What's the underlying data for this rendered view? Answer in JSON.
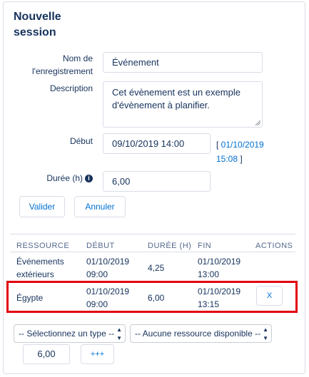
{
  "form": {
    "title": "Nouvelle session",
    "name_label": "Nom de l'enregistrement",
    "name_value": "Événement",
    "description_label": "Description",
    "description_value": "Cet évènement est un exemple d'évènement à planifier.",
    "start_label": "Début",
    "start_value": "09/10/2019 14:00",
    "start_suggestion_open": "[ ",
    "start_suggestion_link": "01/10/2019 15:08",
    "start_suggestion_close": " ]",
    "duration_label": "Durée (h)",
    "duration_value": "6,00",
    "validate_label": "Valider",
    "cancel_label": "Annuler"
  },
  "table": {
    "headers": [
      "RESSOURCE",
      "DÉBUT",
      "DURÉE (H)",
      "FIN",
      "ACTIONS"
    ],
    "rows": [
      {
        "resource": "Événements extérieurs",
        "start": "01/10/2019 09:00",
        "duration": "4,25",
        "end": "01/10/2019 13:00",
        "action": ""
      },
      {
        "resource": "Égypte",
        "start": "01/10/2019 09:00",
        "duration": "6,00",
        "end": "01/10/2019 13:15",
        "action": "X"
      }
    ]
  },
  "add": {
    "type_select": "-- Sélectionnez un type --",
    "resource_select": "-- Aucune ressource disponible --",
    "duration_value": "6,00",
    "add_label": "+++"
  },
  "colors": {
    "link": "#0070d2",
    "text": "#16325c",
    "highlight": "#e3000f"
  }
}
